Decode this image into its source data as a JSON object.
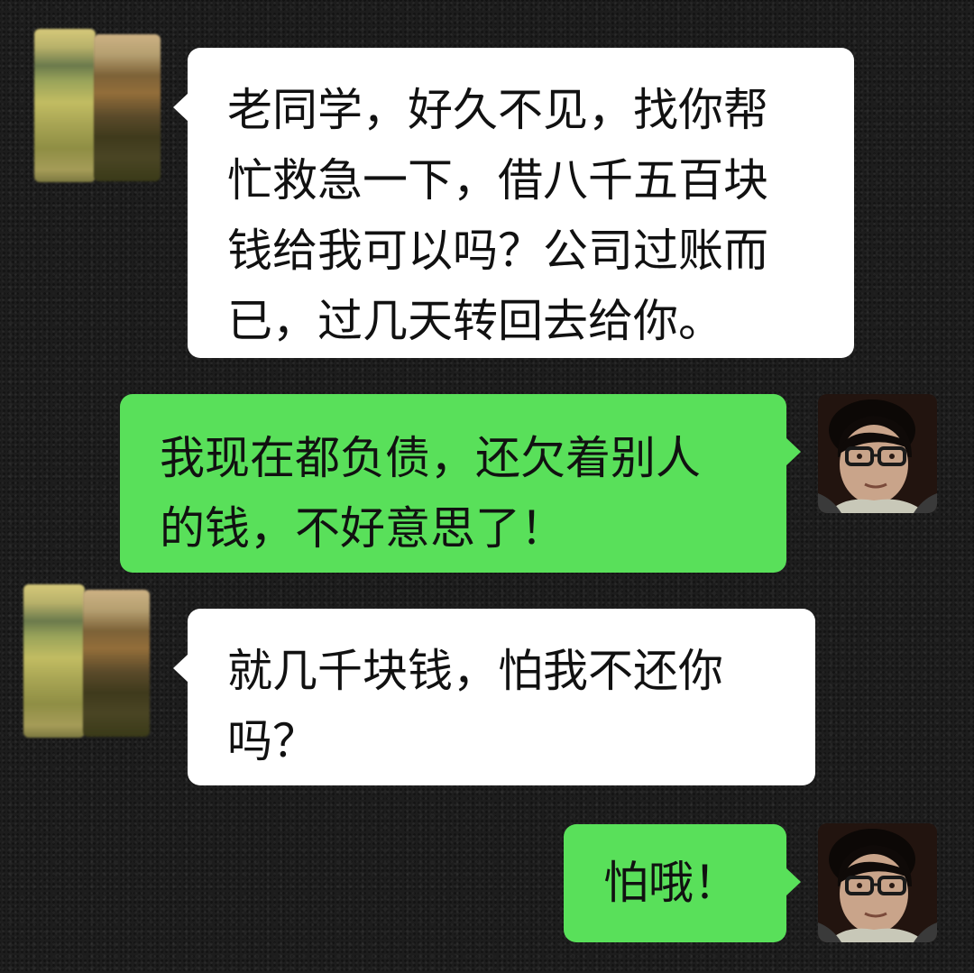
{
  "messages": [
    {
      "from": "other",
      "lines": [
        "老同学，好久不见，找你帮",
        "忙救急一下，借八千五百块",
        "钱给我可以吗？公司过账而",
        "已，过几天转回去给你。"
      ]
    },
    {
      "from": "me",
      "lines": [
        "我现在都负债，还欠着别人",
        "的钱，不好意思了！"
      ]
    },
    {
      "from": "other",
      "lines": [
        "就几千块钱，怕我不还你",
        "吗？"
      ]
    },
    {
      "from": "me",
      "lines": [
        "怕哦！"
      ]
    }
  ],
  "colors": {
    "received_bubble": "#ffffff",
    "sent_bubble": "#59e05a",
    "text": "#111111",
    "background": "#1d1d1d"
  },
  "icons": {
    "other_avatar": "blurred-avatar-icon",
    "my_avatar": "person-avatar-icon"
  }
}
